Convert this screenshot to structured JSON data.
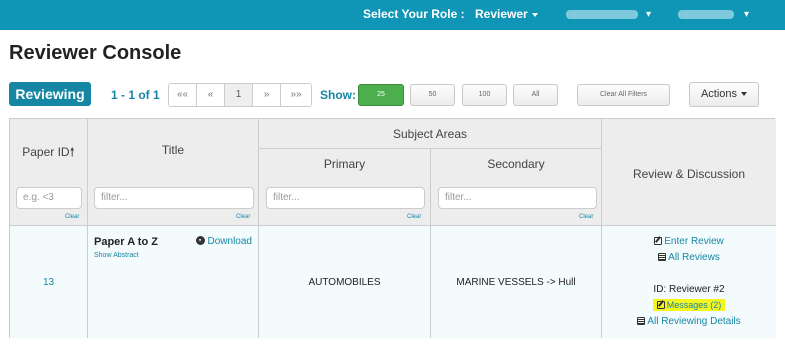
{
  "topbar": {
    "role_label": "Select Your Role :",
    "role_value": "Reviewer"
  },
  "page_title": "Reviewer Console",
  "controls": {
    "reviewing_badge": "Reviewing",
    "range": "1 - 1 of 1",
    "pager": [
      "««",
      "«",
      "1",
      "»",
      "»»"
    ],
    "show_label": "Show:",
    "show_options": [
      "25",
      "50",
      "100",
      "All"
    ],
    "show_selected": "25",
    "clear_filters": "Clear All Filters",
    "actions": "Actions"
  },
  "table": {
    "headers": {
      "paper_id": "Paper ID",
      "title": "Title",
      "subject_areas": "Subject Areas",
      "primary": "Primary",
      "secondary": "Secondary",
      "review": "Review & Discussion"
    },
    "filters": {
      "paper_id_placeholder": "e.g. <3",
      "title_placeholder": "filter...",
      "primary_placeholder": "filter...",
      "secondary_placeholder": "filter...",
      "clear": "Clear"
    },
    "rows": [
      {
        "paper_id": "13",
        "title": "Paper A to Z",
        "download": "Download",
        "show_abstract": "Show Abstract",
        "primary": "AUTOMOBILES",
        "secondary": "MARINE VESSELS -> Hull",
        "enter_review": "Enter Review",
        "all_reviews": "All Reviews",
        "reviewer_id": "ID: Reviewer #2",
        "messages": "Messages (2)",
        "all_details": "All Reviewing Details"
      }
    ]
  },
  "colors": {
    "brand": "#0f95b6",
    "link": "#1587a4",
    "selected_green": "#4cae4c",
    "highlight": "#f5f520"
  }
}
